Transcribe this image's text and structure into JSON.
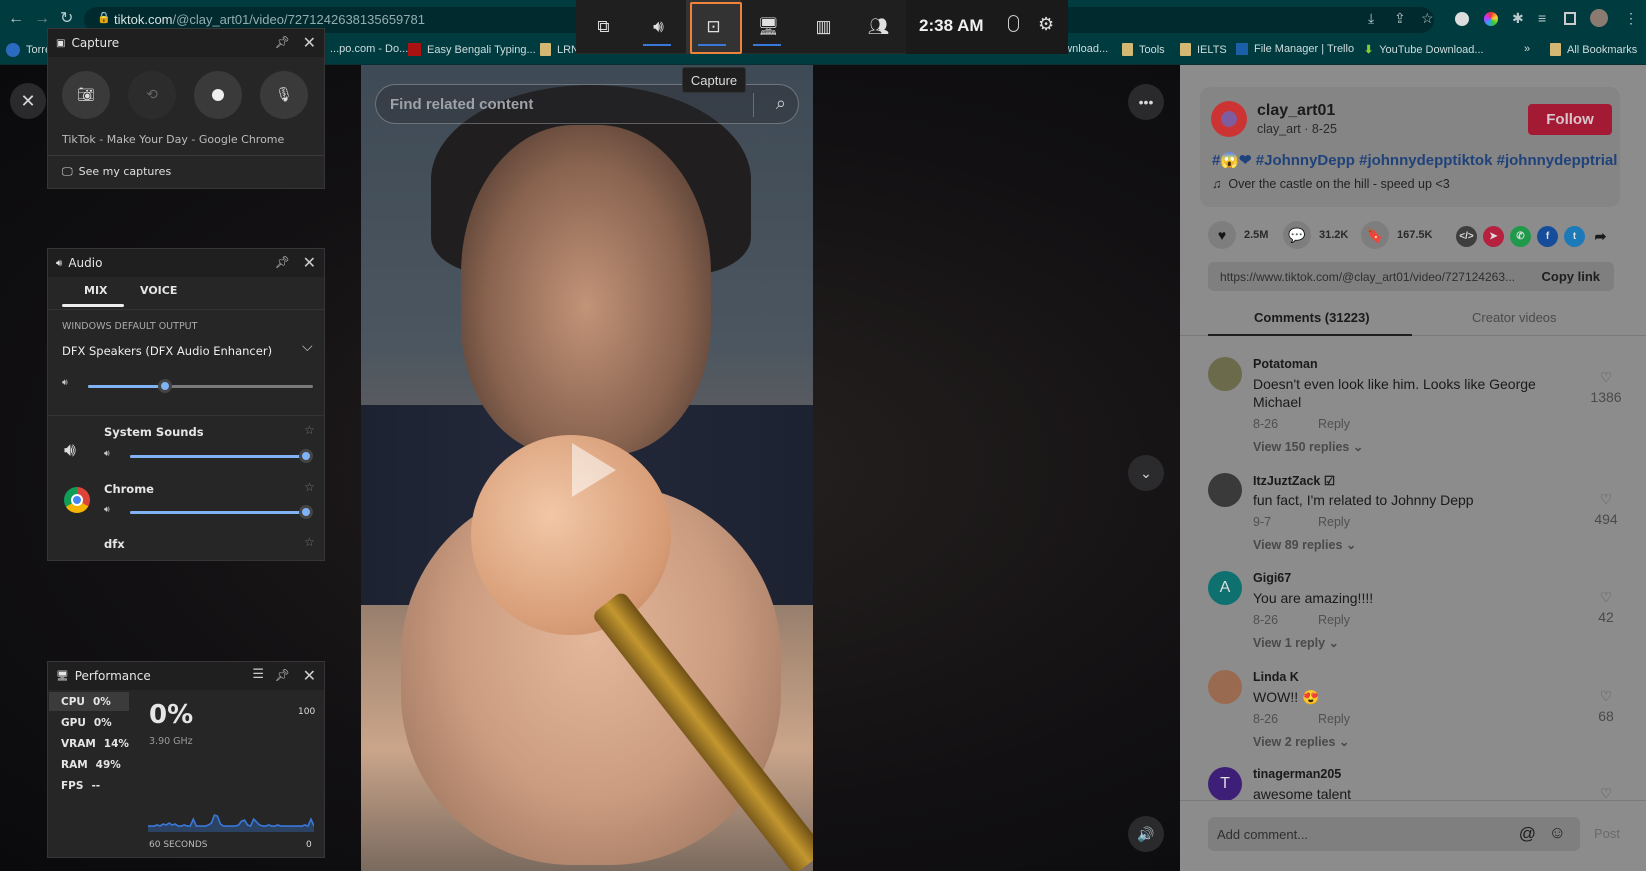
{
  "browser": {
    "url_host": "tiktok.com",
    "url_path": "/@clay_art01/video/7271242638135659781",
    "bookmarks": [
      {
        "label": "Torre",
        "icon": "torrent-icon"
      },
      {
        "label": "...po.com - Do...",
        "icon": "site-icon"
      },
      {
        "label": "Easy Bengali Typing...",
        "icon": "bengali-icon"
      },
      {
        "label": "LRN",
        "icon": "folder-icon"
      },
      {
        "label": "...wnload...",
        "icon": "folder-icon"
      },
      {
        "label": "Tools",
        "icon": "folder-icon"
      },
      {
        "label": "IELTS",
        "icon": "folder-icon"
      },
      {
        "label": "File Manager | Trello",
        "icon": "trello-icon"
      },
      {
        "label": "YouTube Download...",
        "icon": "download-icon"
      },
      {
        "label": "»",
        "icon": ""
      },
      {
        "label": "All Bookmarks",
        "icon": "folder-icon"
      }
    ]
  },
  "gamebar": {
    "time": "2:38 AM",
    "widgets": [
      "widget-menu",
      "audio",
      "capture",
      "performance",
      "resources",
      "social"
    ],
    "tooltip": "Capture",
    "accent": "#3a78d8",
    "highlight": "#f0833a"
  },
  "capture": {
    "title": "Capture",
    "window_name": "TikTok - Make Your Day - Google Chrome",
    "see_captures": "See my captures"
  },
  "audio": {
    "title": "Audio",
    "tabs": [
      "MIX",
      "VOICE"
    ],
    "active_tab": "MIX",
    "section": "WINDOWS DEFAULT OUTPUT",
    "device": "DFX Speakers (DFX Audio Enhancer)",
    "master_volume": 34,
    "apps": [
      {
        "name": "System Sounds",
        "volume": 100
      },
      {
        "name": "Chrome",
        "volume": 100
      },
      {
        "name": "dfx",
        "volume": 100
      }
    ]
  },
  "performance": {
    "title": "Performance",
    "metrics": [
      {
        "label": "CPU",
        "value": "0%"
      },
      {
        "label": "GPU",
        "value": "0%"
      },
      {
        "label": "VRAM",
        "value": "14%"
      },
      {
        "label": "RAM",
        "value": "49%"
      },
      {
        "label": "FPS",
        "value": "--"
      }
    ],
    "big_value": "0%",
    "frequency": "3.90 GHz",
    "max": "100",
    "min": "0",
    "window": "60 SECONDS",
    "history": [
      2,
      2,
      2,
      3,
      2,
      4,
      3,
      5,
      3,
      4,
      2,
      2,
      3,
      2,
      2,
      9,
      2,
      2,
      2,
      2,
      3,
      5,
      13,
      12,
      4,
      2,
      2,
      2,
      2,
      2,
      3,
      7,
      8,
      3,
      2,
      9,
      6,
      3,
      2,
      2,
      3,
      2,
      2,
      3,
      2,
      2,
      2,
      2,
      2,
      2,
      2,
      2,
      3,
      2,
      9,
      2
    ]
  },
  "video": {
    "search_placeholder": "Find related content"
  },
  "post": {
    "username": "clay_art01",
    "nickname": "clay_art",
    "date": "8-25",
    "follow": "Follow",
    "caption": "#😱❤ #JohnnyDepp #johnnydepptiktok #johnnydepptrial",
    "music": "Over the castle on the hill - speed up <3",
    "likes": "2.5M",
    "comments": "31.2K",
    "saves": "167.5K",
    "link": "https://www.tiktok.com/@clay_art01/video/727124263...",
    "copy_link": "Copy link",
    "tabs": [
      "Comments (31223)",
      "Creator videos"
    ]
  },
  "comments": [
    {
      "user": "Potatoman",
      "text": "Doesn't even look like him. Looks like George Michael",
      "date": "8-26",
      "reply": "Reply",
      "replies": "View 150 replies",
      "likes": "1386",
      "avatar_color": "#6b6a4a"
    },
    {
      "user": "ItzJuztZack ☑",
      "text": "fun fact, I'm related to Johnny Depp",
      "date": "9-7",
      "reply": "Reply",
      "replies": "View 89 replies",
      "likes": "494",
      "avatar_color": "#3a3a3a"
    },
    {
      "user": "Gigi67",
      "text": "You are amazing!!!!",
      "date": "8-26",
      "reply": "Reply",
      "replies": "View 1 reply",
      "likes": "42",
      "avatar_color": "#0f7070",
      "initial": "A"
    },
    {
      "user": "Linda K",
      "text": "WOW!! 😍",
      "date": "8-26",
      "reply": "Reply",
      "replies": "View 2 replies",
      "likes": "68",
      "avatar_color": "#9a6a50"
    },
    {
      "user": "tinagerman205",
      "text": "awesome talent",
      "date": "",
      "reply": "",
      "replies": "",
      "likes": "",
      "avatar_color": "#3d1f78",
      "initial": "T"
    }
  ],
  "composer": {
    "placeholder": "Add comment...",
    "post": "Post"
  }
}
